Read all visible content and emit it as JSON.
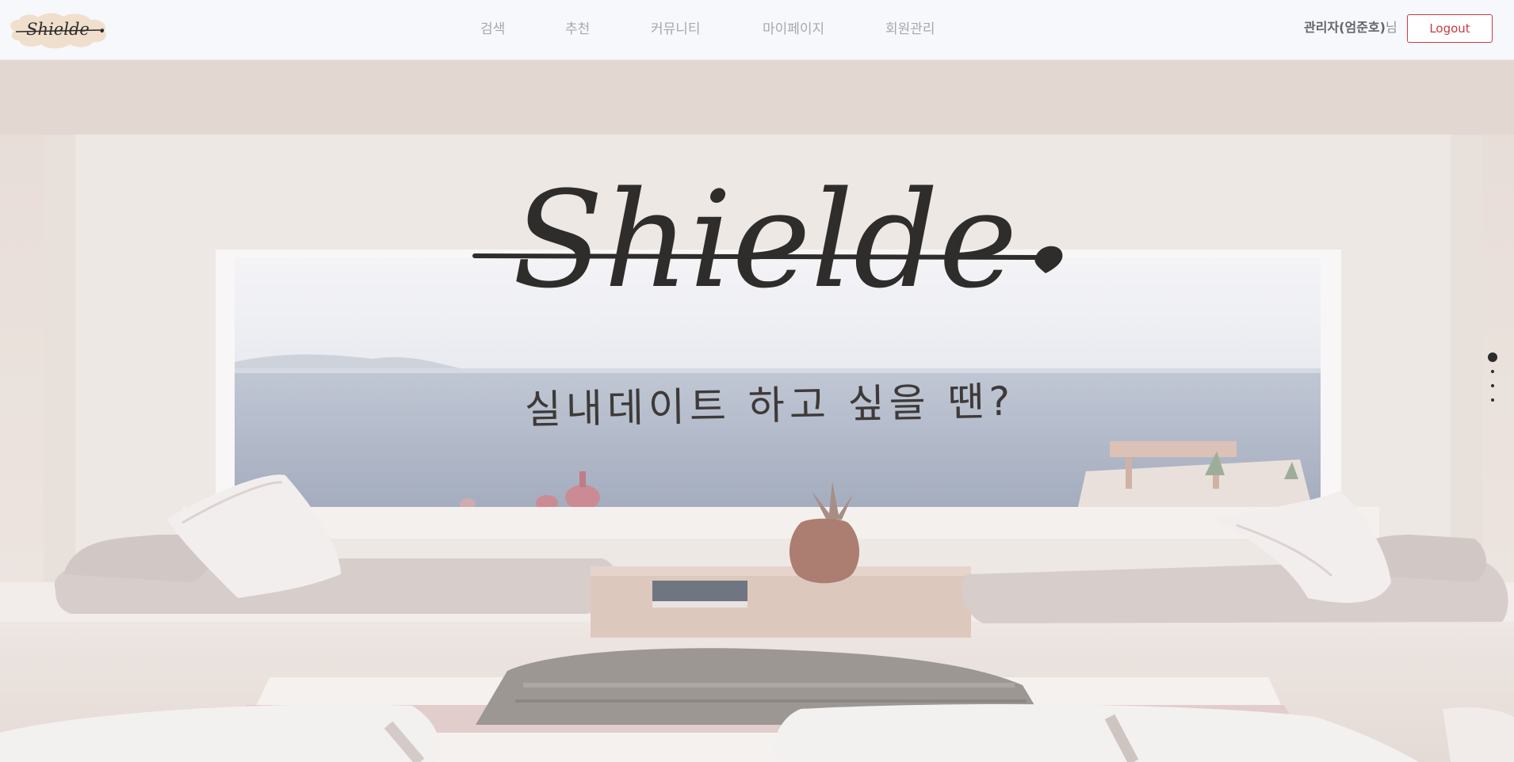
{
  "brand": {
    "name": "Shielde"
  },
  "nav": {
    "items": [
      "검색",
      "추천",
      "커뮤니티",
      "마이페이지",
      "회원관리"
    ]
  },
  "user": {
    "name": "관리자(엄준호)",
    "suffix": "님",
    "logout_label": "Logout"
  },
  "hero": {
    "brand_text": "Shielde",
    "tagline": "실내데이트 하고 싶을 땐?",
    "slides_total": 4,
    "active_slide": 1
  },
  "colors": {
    "accent": "#c93a45",
    "nav_text": "#a5a8ae",
    "header_bg": "#f6f8fb",
    "logo_cloud": "#f0dfcc"
  },
  "icons": {
    "logo": "shielde-cloud-logo",
    "heart": "heart-icon",
    "slider_dot": "dot-icon"
  }
}
